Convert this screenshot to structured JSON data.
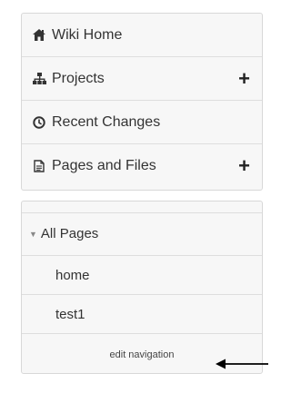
{
  "nav": {
    "items": [
      {
        "label": "Wiki Home",
        "icon": "home-icon",
        "has_add": false
      },
      {
        "label": "Projects",
        "icon": "sitemap-icon",
        "has_add": true
      },
      {
        "label": "Recent Changes",
        "icon": "clock-icon",
        "has_add": false
      },
      {
        "label": "Pages and Files",
        "icon": "file-icon",
        "has_add": true
      }
    ],
    "add_symbol": "+"
  },
  "pages": {
    "section_label": "All Pages",
    "items": [
      "home",
      "test1"
    ],
    "edit_label": "edit navigation"
  },
  "colors": {
    "panel_bg": "#f7f7f7",
    "border": "#d8d8d8",
    "text": "#333333"
  }
}
